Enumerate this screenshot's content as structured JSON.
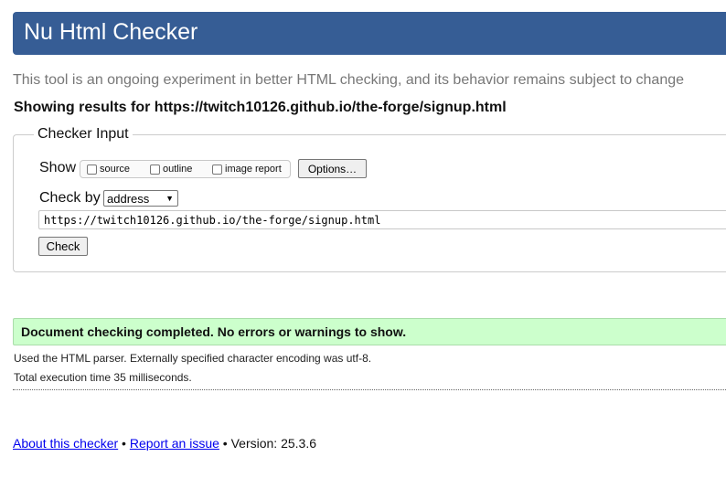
{
  "header": {
    "title": "Nu Html Checker"
  },
  "tagline": "This tool is an ongoing experiment in better HTML checking, and its behavior remains subject to change",
  "showing": "Showing results for https://twitch10126.github.io/the-forge/signup.html",
  "checker_input": {
    "legend": "Checker Input",
    "show_label": "Show",
    "show_options": [
      {
        "label": "source",
        "checked": false
      },
      {
        "label": "outline",
        "checked": false
      },
      {
        "label": "image report",
        "checked": false
      }
    ],
    "options_button": "Options…",
    "check_by_label": "Check by",
    "check_by_selected": "address",
    "url_value": "https://twitch10126.github.io/the-forge/signup.html",
    "check_button": "Check"
  },
  "result": {
    "success_message": "Document checking completed. No errors or warnings to show.",
    "parser_info": "Used the HTML parser. Externally specified character encoding was utf-8.",
    "execution_time": "Total execution time 35 milliseconds."
  },
  "footer": {
    "about_link": "About this checker",
    "separator1": " • ",
    "report_link": "Report an issue",
    "separator2": " • ",
    "version_text": "Version: 25.3.6"
  },
  "colors": {
    "header_bg": "#365d95",
    "success_bg": "#ccffcc",
    "link": "#0000ee"
  }
}
